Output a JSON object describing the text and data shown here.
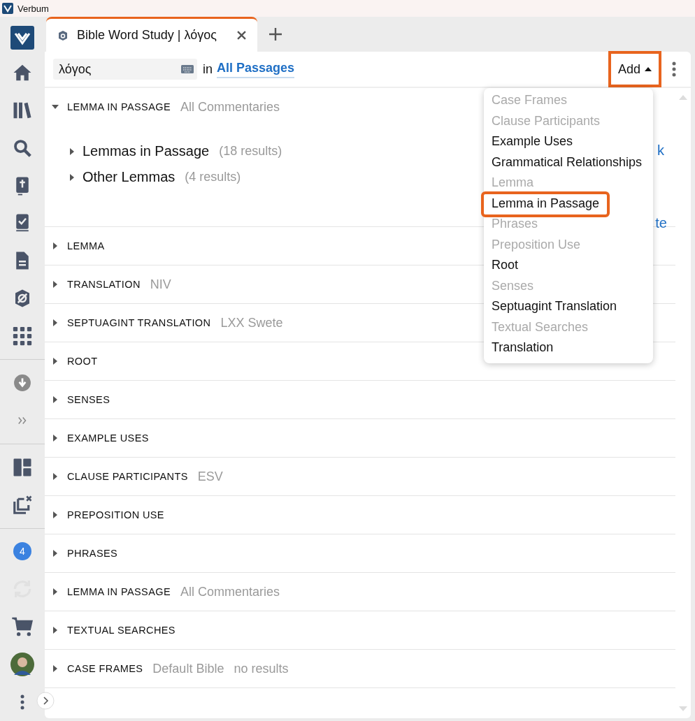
{
  "app": {
    "title": "Verbum"
  },
  "sidebar": {
    "groups": [
      {
        "items": [
          {
            "kind": "logo",
            "disabled": false
          },
          {
            "kind": "home",
            "disabled": false
          },
          {
            "kind": "library",
            "disabled": false
          },
          {
            "kind": "search",
            "disabled": false
          },
          {
            "kind": "bible",
            "disabled": false
          },
          {
            "kind": "checklist",
            "disabled": false
          },
          {
            "kind": "document",
            "disabled": false
          },
          {
            "kind": "shield",
            "disabled": false
          },
          {
            "kind": "grid",
            "disabled": false
          }
        ]
      },
      {
        "items": [
          {
            "kind": "download",
            "disabled": false
          },
          {
            "kind": "chevrons",
            "disabled": false
          }
        ]
      },
      {
        "items": [
          {
            "kind": "layout",
            "disabled": false
          },
          {
            "kind": "close-panels",
            "disabled": false
          }
        ]
      },
      {
        "items": [
          {
            "kind": "badge",
            "label": "4",
            "disabled": false
          },
          {
            "kind": "sync",
            "disabled": true
          },
          {
            "kind": "cart",
            "disabled": false
          },
          {
            "kind": "avatar",
            "disabled": false
          },
          {
            "kind": "more",
            "disabled": false
          }
        ]
      }
    ]
  },
  "tabs": [
    {
      "title": "Bible Word Study | λόγος",
      "selected": true
    }
  ],
  "toolbar": {
    "search": {
      "value": "λόγος"
    },
    "range_prefix": "in",
    "range": "All Passages",
    "add_button": {
      "label": "Add",
      "highlighted": true
    }
  },
  "add_menu": {
    "items": [
      {
        "label": "Case Frames",
        "disabled": true,
        "highlighted": false
      },
      {
        "label": "Clause Participants",
        "disabled": true,
        "highlighted": false
      },
      {
        "label": "Example Uses",
        "disabled": false,
        "highlighted": false
      },
      {
        "label": "Grammatical Relationships",
        "disabled": false,
        "highlighted": false
      },
      {
        "label": "Lemma",
        "disabled": true,
        "highlighted": false
      },
      {
        "label": "Lemma in Passage",
        "disabled": false,
        "highlighted": true
      },
      {
        "label": "Phrases",
        "disabled": true,
        "highlighted": false
      },
      {
        "label": "Preposition Use",
        "disabled": true,
        "highlighted": false
      },
      {
        "label": "Root",
        "disabled": false,
        "highlighted": false
      },
      {
        "label": "Senses",
        "disabled": true,
        "highlighted": false
      },
      {
        "label": "Septuagint Translation",
        "disabled": false,
        "highlighted": false
      },
      {
        "label": "Textual Searches",
        "disabled": true,
        "highlighted": false
      },
      {
        "label": "Translation",
        "disabled": false,
        "highlighted": false
      }
    ]
  },
  "sections": [
    {
      "title": "LEMMA IN PASSAGE",
      "subtitle": "All Commentaries",
      "expanded": true,
      "children": [
        {
          "label": "Lemmas in Passage",
          "count": "(18 results)"
        },
        {
          "label": "Other Lemmas",
          "count": "(4 results)"
        }
      ],
      "link_fragments": [
        "k",
        "te"
      ]
    },
    {
      "title": "LEMMA",
      "expanded": false
    },
    {
      "title": "TRANSLATION",
      "subtitle": "NIV",
      "expanded": false
    },
    {
      "title": "SEPTUAGINT TRANSLATION",
      "subtitle": "LXX Swete",
      "expanded": false
    },
    {
      "title": "ROOT",
      "expanded": false
    },
    {
      "title": "SENSES",
      "expanded": false
    },
    {
      "title": "EXAMPLE USES",
      "expanded": false
    },
    {
      "title": "CLAUSE PARTICIPANTS",
      "subtitle": "ESV",
      "expanded": false
    },
    {
      "title": "PREPOSITION USE",
      "expanded": false
    },
    {
      "title": "PHRASES",
      "expanded": false
    },
    {
      "title": "LEMMA IN PASSAGE",
      "subtitle": "All Commentaries",
      "expanded": false
    },
    {
      "title": "TEXTUAL SEARCHES",
      "expanded": false
    },
    {
      "title": "CASE FRAMES",
      "subtitle": "Default Bible",
      "status": "no results",
      "expanded": false
    }
  ]
}
